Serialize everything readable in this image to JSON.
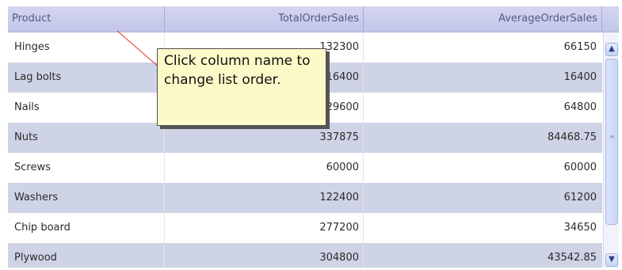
{
  "columns": {
    "product": "Product",
    "total": "TotalOrderSales",
    "average": "AverageOrderSales"
  },
  "rows": [
    {
      "product": "Hinges",
      "total": "132300",
      "average": "66150"
    },
    {
      "product": "Lag bolts",
      "total": "16400",
      "average": "16400"
    },
    {
      "product": "Nails",
      "total": "129600",
      "average": "64800"
    },
    {
      "product": "Nuts",
      "total": "337875",
      "average": "84468.75"
    },
    {
      "product": "Screws",
      "total": "60000",
      "average": "60000"
    },
    {
      "product": "Washers",
      "total": "122400",
      "average": "61200"
    },
    {
      "product": "Chip board",
      "total": "277200",
      "average": "34650"
    },
    {
      "product": "Plywood",
      "total": "304800",
      "average": "43542.85"
    }
  ],
  "callout": {
    "text": "Click column name to change list order."
  },
  "icons": {
    "scroll_up": "chevron-up-icon",
    "scroll_down": "chevron-down-icon",
    "scroll_grip": "grip-icon"
  }
}
